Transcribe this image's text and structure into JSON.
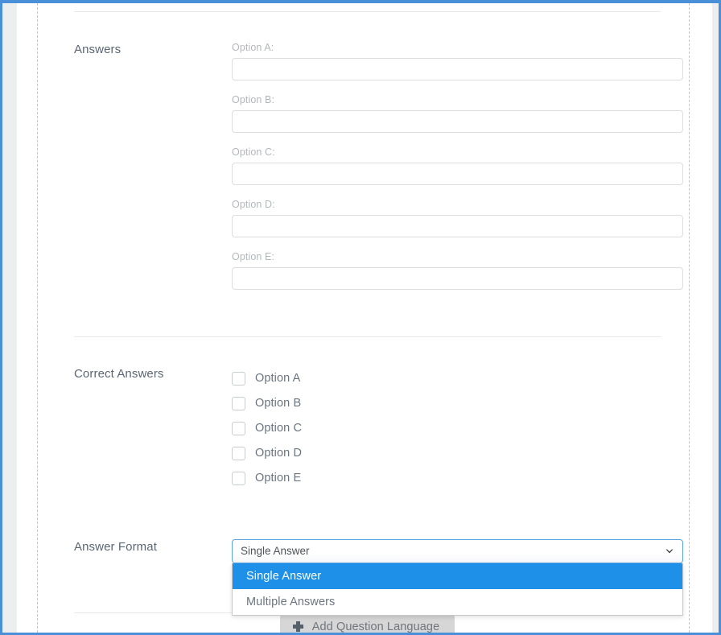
{
  "theme": {
    "frame_border": "#4a90d9",
    "accent": "#1e90e8",
    "select_focus_border": "#5ba2e0",
    "label_color": "#5a6773",
    "caption_color": "#b4b7ba",
    "divider": "#e8e8e8",
    "dashed_guide": "#c4c4c4",
    "button_bg": "#d6d6d6"
  },
  "answers": {
    "label": "Answers",
    "options": [
      {
        "caption": "Option A:",
        "value": "",
        "placeholder": ""
      },
      {
        "caption": "Option B:",
        "value": "",
        "placeholder": ""
      },
      {
        "caption": "Option C:",
        "value": "",
        "placeholder": ""
      },
      {
        "caption": "Option D:",
        "value": "",
        "placeholder": ""
      },
      {
        "caption": "Option E:",
        "value": "",
        "placeholder": ""
      }
    ]
  },
  "correct_answers": {
    "label": "Correct Answers",
    "items": [
      {
        "label": "Option A",
        "checked": false
      },
      {
        "label": "Option B",
        "checked": false
      },
      {
        "label": "Option C",
        "checked": false
      },
      {
        "label": "Option D",
        "checked": false
      },
      {
        "label": "Option E",
        "checked": false
      }
    ]
  },
  "answer_format": {
    "label": "Answer Format",
    "selected": "Single Answer",
    "expanded": true,
    "options": [
      {
        "label": "Single Answer",
        "highlighted": true
      },
      {
        "label": "Multiple Answers",
        "highlighted": false
      }
    ],
    "chevron_icon": "chevron-down-icon"
  },
  "footer": {
    "add_language_label": "Add Question Language",
    "add_language_icon": "plus-icon"
  }
}
